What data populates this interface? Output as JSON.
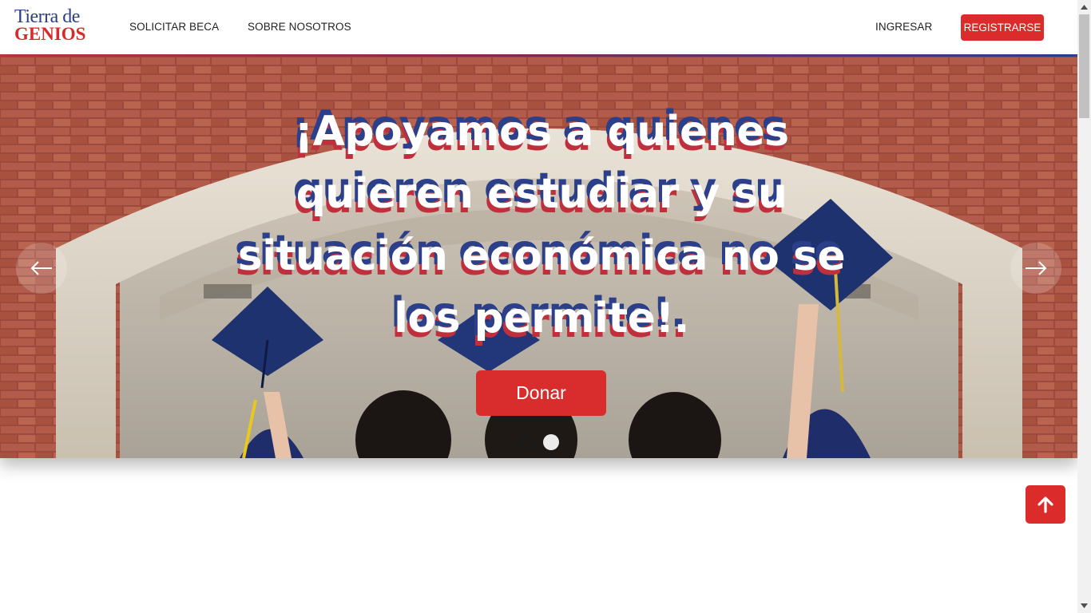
{
  "logo": {
    "line1": "Tierra de",
    "line2": "GENIOS"
  },
  "nav": {
    "links": [
      {
        "label": "SOLICITAR BECA"
      },
      {
        "label": "SOBRE NOSOTROS"
      }
    ],
    "login_label": "INGRESAR",
    "register_label": "REGISTRARSE"
  },
  "hero": {
    "title": "¡Apoyamos a quienes quieren estudiar y su situación económica no se los permite!.",
    "donate_label": "Donar",
    "slides_total": 2,
    "active_slide": 1
  },
  "colors": {
    "brand_red": "#db2b2b",
    "brand_blue": "#2c3f8a"
  },
  "icons": {
    "prev": "arrow-left-icon",
    "next": "arrow-right-icon",
    "scroll_top": "arrow-up-icon"
  }
}
